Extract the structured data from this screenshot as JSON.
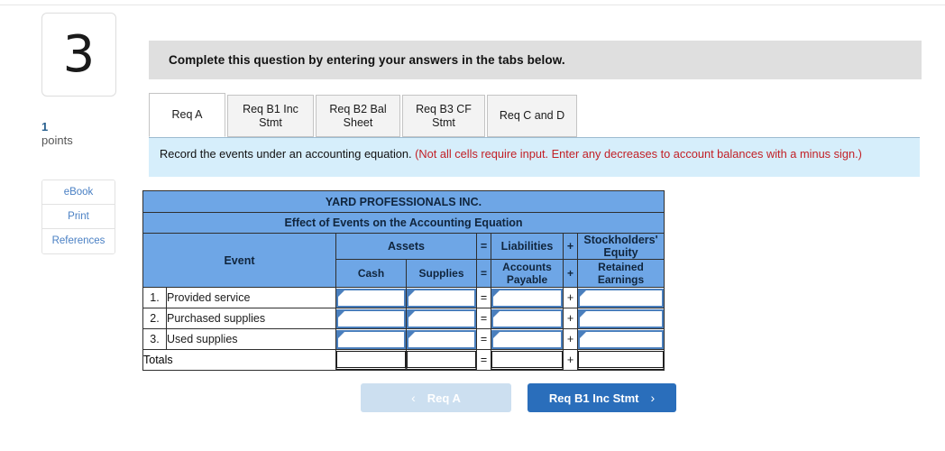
{
  "question": {
    "number": "3",
    "points_value": "1",
    "points_label": "points"
  },
  "rail": {
    "buttons": [
      {
        "label": "eBook",
        "name": "ebook-button"
      },
      {
        "label": "Print",
        "name": "print-button"
      },
      {
        "label": "References",
        "name": "references-button"
      }
    ]
  },
  "banner": {
    "text": "Complete this question by entering your answers in the tabs below."
  },
  "tabs": [
    {
      "label": "Req A",
      "active": true
    },
    {
      "label": "Req B1 Inc Stmt",
      "active": false
    },
    {
      "label": "Req B2 Bal Sheet",
      "active": false
    },
    {
      "label": "Req B3 CF Stmt",
      "active": false
    },
    {
      "label": "Req C and D",
      "active": false
    }
  ],
  "instruction": {
    "main": "Record the events under an accounting equation. ",
    "note": "(Not all cells require input. Enter any decreases to account balances with a minus sign.)"
  },
  "table": {
    "company_title": "YARD PROFESSIONALS INC.",
    "subtitle": "Effect of Events on the Accounting Equation",
    "event_header": "Event",
    "group_headers": {
      "assets": "Assets",
      "equals": "=",
      "liabilities": "Liabilities",
      "plus": "+",
      "stockholders_equity": "Stockholders' Equity"
    },
    "column_headers": {
      "cash": "Cash",
      "supplies": "Supplies",
      "equals": "=",
      "accounts_payable": "Accounts Payable",
      "plus": "+",
      "retained_earnings": "Retained Earnings"
    },
    "rows": [
      {
        "number": "1.",
        "label": "Provided service",
        "cash": "",
        "supplies": "",
        "equals": "=",
        "accounts_payable": "",
        "plus": "+",
        "retained_earnings": ""
      },
      {
        "number": "2.",
        "label": "Purchased supplies",
        "cash": "",
        "supplies": "",
        "equals": "=",
        "accounts_payable": "",
        "plus": "+",
        "retained_earnings": ""
      },
      {
        "number": "3.",
        "label": "Used supplies",
        "cash": "",
        "supplies": "",
        "equals": "=",
        "accounts_payable": "",
        "plus": "+",
        "retained_earnings": ""
      }
    ],
    "totals": {
      "label": "Totals",
      "cash": "",
      "supplies": "",
      "equals": "=",
      "accounts_payable": "",
      "plus": "+",
      "retained_earnings": ""
    }
  },
  "nav": {
    "prev": {
      "label": "Req A",
      "icon": "chevron-left-icon",
      "glyph": "‹",
      "disabled": true
    },
    "next": {
      "label": "Req B1 Inc Stmt",
      "icon": "chevron-right-icon",
      "glyph": "›",
      "disabled": false
    }
  },
  "colors": {
    "header_blue": "#6ea6e6",
    "input_border": "#4a7fbd",
    "info_bg": "#d6eefb",
    "banner_gray": "#dfdfdf",
    "primary_button": "#2a6ebb",
    "disabled_button": "#ccdff0",
    "red_note": "#c22026",
    "link_blue": "#4a80c4"
  }
}
